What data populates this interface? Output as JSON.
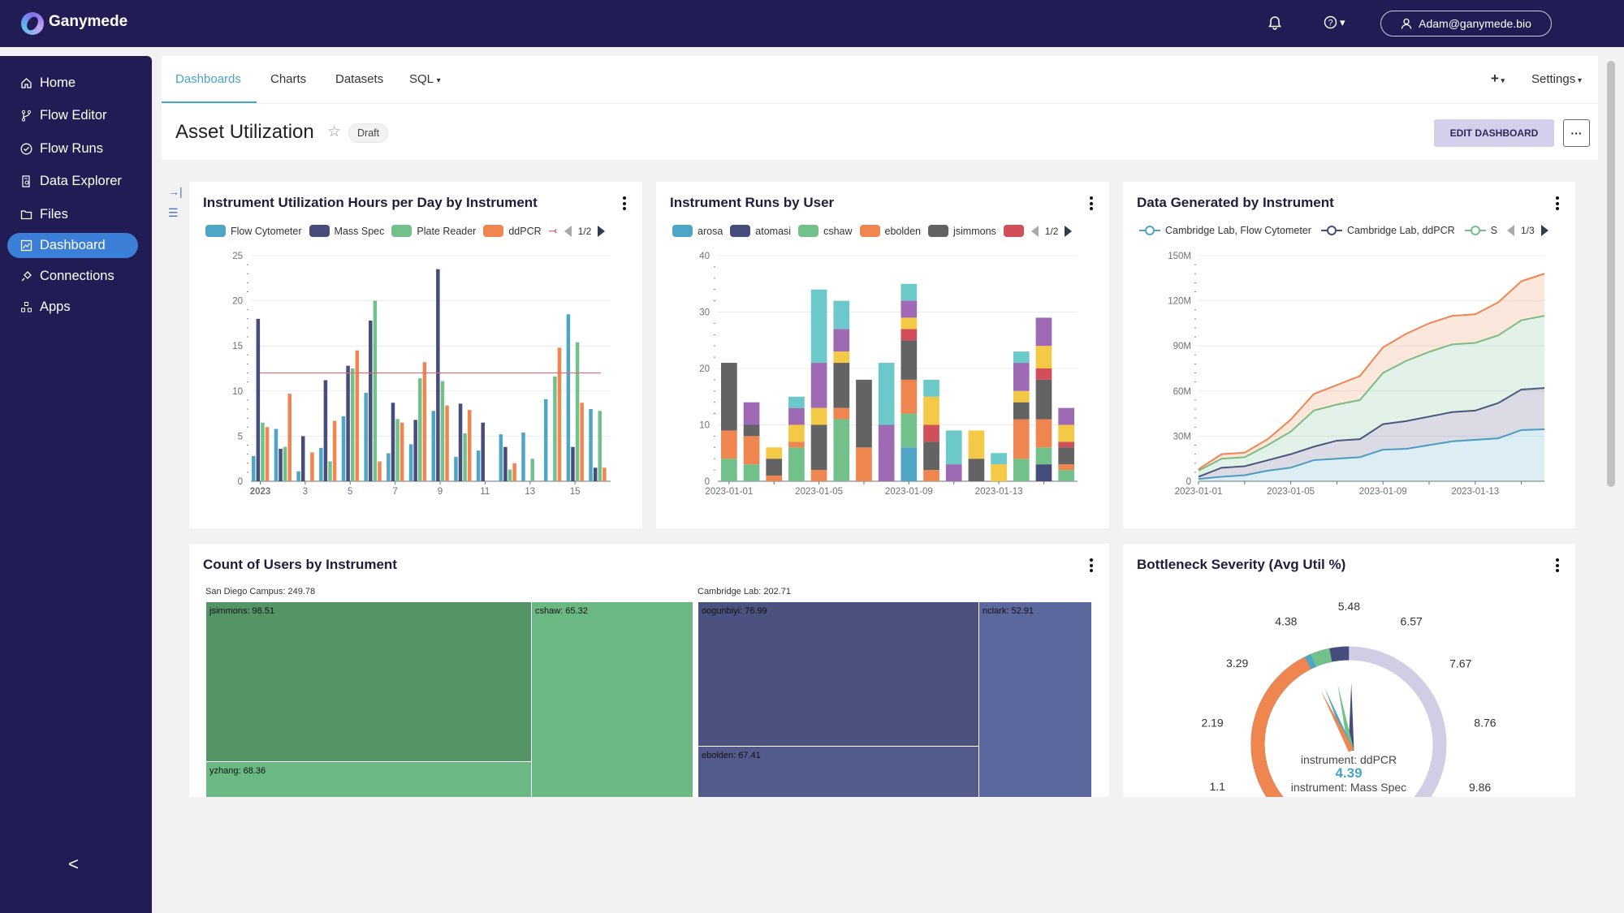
{
  "app": {
    "name": "Ganymede"
  },
  "header": {
    "user": "Adam@ganymede.bio",
    "bell_icon": "bell-icon",
    "help_icon": "help-icon"
  },
  "sidebar": {
    "items": [
      {
        "label": "Home",
        "icon": "home-icon"
      },
      {
        "label": "Flow Editor",
        "icon": "branch-icon"
      },
      {
        "label": "Flow Runs",
        "icon": "check-circle-icon"
      },
      {
        "label": "Data Explorer",
        "icon": "file-search-icon"
      },
      {
        "label": "Files",
        "icon": "folder-icon"
      },
      {
        "label": "Dashboard",
        "icon": "chart-icon"
      },
      {
        "label": "Connections",
        "icon": "plug-icon"
      },
      {
        "label": "Apps",
        "icon": "apps-icon"
      }
    ],
    "active": "Dashboard",
    "collapse": "<"
  },
  "tabs": [
    {
      "label": "Dashboards"
    },
    {
      "label": "Charts"
    },
    {
      "label": "Datasets"
    },
    {
      "label": "SQL"
    }
  ],
  "toolbar": {
    "plus": "+",
    "settings": "Settings"
  },
  "dashboard": {
    "title": "Asset Utilization",
    "status": "Draft",
    "edit_label": "EDIT DASHBOARD",
    "more_label": "···"
  },
  "colors": {
    "accent": "#4aa3c9",
    "nav_bg": "#211d54",
    "active_nav": "#3b7fd8"
  },
  "chart_data": [
    {
      "type": "bar",
      "title": "Instrument Utilization Hours per Day by Instrument",
      "legend_page": "1/2",
      "categories": [
        "2023-01-01",
        "2023-01-02",
        "2023-01-03",
        "2023-01-04",
        "2023-01-05",
        "2023-01-06",
        "2023-01-07",
        "2023-01-08",
        "2023-01-09",
        "2023-01-10",
        "2023-01-11",
        "2023-01-12",
        "2023-01-13",
        "2023-01-14",
        "2023-01-15",
        "2023-01-16"
      ],
      "tick_labels": [
        "2023",
        "3",
        "5",
        "7",
        "9",
        "11",
        "13",
        "15"
      ],
      "ylim": [
        0,
        25
      ],
      "yticks": [
        0,
        5,
        10,
        15,
        20,
        25
      ],
      "grid": true,
      "legend": "top",
      "mark_line": 12,
      "mark_line_color": "#e06b73",
      "series": [
        {
          "name": "Flow Cytometer",
          "color": "#4ea5c6",
          "values": [
            2.8,
            5.8,
            1.1,
            3.7,
            7.2,
            9.8,
            3.1,
            4.1,
            7.8,
            2.7,
            3.4,
            5.2,
            5.4,
            9.1,
            18.5,
            8
          ]
        },
        {
          "name": "Mass Spec",
          "color": "#464c7c",
          "values": [
            18,
            3.6,
            5,
            11.2,
            12.8,
            17.8,
            8.7,
            6.8,
            23.5,
            8.6,
            6.5,
            3.8,
            0,
            0,
            3.8,
            1.5
          ]
        },
        {
          "name": "Plate Reader",
          "color": "#72c08a",
          "values": [
            6.5,
            3.8,
            0,
            2.2,
            12.5,
            20,
            6.9,
            11.4,
            11.1,
            5.3,
            0,
            1.3,
            2.5,
            11.6,
            15.4,
            7.8
          ]
        },
        {
          "name": "ddPCR",
          "color": "#ef8650",
          "values": [
            6,
            9.7,
            3.2,
            6.7,
            14.5,
            2.2,
            6.5,
            13.2,
            8.4,
            7.9,
            0,
            2,
            0,
            14.8,
            8.7,
            1.5
          ]
        }
      ]
    },
    {
      "type": "bar",
      "stacked": true,
      "title": "Instrument Runs by User",
      "legend_page": "1/2",
      "categories": [
        "2023-01-01",
        "2023-01-02",
        "2023-01-03",
        "2023-01-04",
        "2023-01-05",
        "2023-01-06",
        "2023-01-07",
        "2023-01-08",
        "2023-01-09",
        "2023-01-10",
        "2023-01-11",
        "2023-01-12",
        "2023-01-13",
        "2023-01-14",
        "2023-01-15",
        "2023-01-16"
      ],
      "tick_labels": [
        "2023-01-01",
        "2023-01-05",
        "2023-01-09",
        "2023-01-13"
      ],
      "ylim": [
        0,
        40
      ],
      "yticks": [
        0,
        10,
        20,
        30,
        40
      ],
      "grid": true,
      "legend": "top",
      "series": [
        {
          "name": "arosa",
          "color": "#4ea5c6",
          "values": [
            0,
            0,
            0,
            0,
            0,
            0,
            0,
            0,
            6,
            0,
            0,
            0,
            0,
            0,
            0,
            0
          ]
        },
        {
          "name": "atomasi",
          "color": "#464c7c",
          "values": [
            0,
            0,
            0,
            0,
            0,
            0,
            0,
            0,
            0,
            0,
            0,
            0,
            0,
            0,
            3,
            0
          ]
        },
        {
          "name": "cshaw",
          "color": "#72c08a",
          "values": [
            4,
            3,
            0,
            6,
            0,
            11,
            0,
            0,
            6,
            0,
            0,
            0,
            0,
            4,
            3,
            2
          ]
        },
        {
          "name": "ebolden",
          "color": "#ef8650",
          "values": [
            5,
            5,
            1,
            1,
            2,
            2,
            6,
            0,
            6,
            2,
            0,
            0,
            0,
            7,
            5,
            1
          ]
        },
        {
          "name": "jsimmons",
          "color": "#636363",
          "values": [
            12,
            2,
            3,
            0,
            8,
            8,
            12,
            0,
            7,
            5,
            0,
            4,
            0,
            3,
            7,
            3
          ]
        },
        {
          "color": "#d04f58",
          "values": [
            0,
            0,
            0,
            0,
            0,
            0,
            0,
            0,
            2,
            3,
            0,
            0,
            0,
            0,
            2,
            1
          ]
        },
        {
          "color": "#f4c945",
          "values": [
            0,
            0,
            2,
            3,
            3,
            2,
            0,
            0,
            2,
            5,
            0,
            5,
            3,
            2,
            4,
            3
          ]
        },
        {
          "color": "#9e6ab4",
          "values": [
            0,
            4,
            0,
            3,
            8,
            4,
            0,
            10,
            3,
            0,
            3,
            0,
            0,
            5,
            5,
            3
          ]
        },
        {
          "color": "#6cc9c9",
          "values": [
            0,
            0,
            0,
            2,
            13,
            5,
            0,
            11,
            3,
            3,
            6,
            0,
            2,
            2,
            0,
            0
          ]
        }
      ]
    },
    {
      "type": "area",
      "stacked": true,
      "title": "Data Generated by Instrument",
      "legend_page": "1/3",
      "x": [
        "2023-01-01",
        "2023-01-02",
        "2023-01-03",
        "2023-01-04",
        "2023-01-05",
        "2023-01-06",
        "2023-01-07",
        "2023-01-08",
        "2023-01-09",
        "2023-01-10",
        "2023-01-11",
        "2023-01-12",
        "2023-01-13",
        "2023-01-14",
        "2023-01-15",
        "2023-01-16"
      ],
      "tick_labels": [
        "2023-01-01",
        "2023-01-05",
        "2023-01-09",
        "2023-01-13"
      ],
      "ylim": [
        0,
        150000000
      ],
      "ytick_labels": [
        "0",
        "30M",
        "60M",
        "90M",
        "120M",
        "150M"
      ],
      "grid": true,
      "legend": "top",
      "series": [
        {
          "name": "Cambridge Lab, Flow Cytometer",
          "color": "#4ea5c6",
          "values": [
            1.5,
            3,
            4,
            7,
            9,
            14,
            15,
            16,
            21,
            21.5,
            24,
            26.5,
            27.5,
            28.5,
            34,
            34.5
          ],
          "unit": "M"
        },
        {
          "name": "Cambridge Lab, ddPCR",
          "color": "#464c7c",
          "values": [
            1.5,
            6,
            6,
            7,
            9,
            9,
            12,
            12,
            17,
            18.5,
            19,
            19.5,
            19.5,
            23.5,
            27,
            27.5
          ],
          "unit": "M"
        },
        {
          "name": "S",
          "color": "#72c08a",
          "values": [
            4,
            6,
            6,
            10,
            15,
            24,
            24,
            26,
            34,
            40,
            43,
            45,
            45,
            45,
            46,
            48
          ],
          "unit": "M"
        },
        {
          "color": "#ef8650",
          "values": [
            1,
            3,
            3,
            4,
            8,
            11,
            13,
            16,
            17,
            18,
            19,
            19,
            19,
            22,
            26,
            28
          ],
          "unit": "M"
        }
      ]
    },
    {
      "type": "treemap",
      "title": "Count of Users by Instrument",
      "groups": [
        {
          "label": "San Diego Campus: 249.78",
          "children": [
            {
              "label": "jsimmons: 98.51",
              "color": "#559467"
            },
            {
              "label": "yzhang: 68.36",
              "color": "#6ab883"
            },
            {
              "label": "cshaw: 65.32",
              "color": "#6ab883"
            }
          ]
        },
        {
          "label": "Cambridge Lab: 202.71",
          "children": [
            {
              "label": "oogunbiyi: 76.99",
              "color": "#4b527f"
            },
            {
              "label": "ebolden: 67.41",
              "color": "#525b8c"
            },
            {
              "label": "nclark: 52.91",
              "color": "#5c679e"
            }
          ]
        }
      ]
    },
    {
      "type": "gauge",
      "title": "Bottleneck Severity (Avg Util %)",
      "min": 0,
      "max": 10.95,
      "axis_labels": [
        "1.1",
        "2.19",
        "3.29",
        "4.38",
        "5.48",
        "6.57",
        "7.67",
        "8.76",
        "9.86"
      ],
      "axis_values": [
        1.1,
        2.19,
        3.29,
        4.38,
        5.48,
        6.57,
        7.67,
        8.76,
        9.86
      ],
      "track_color": "#d1cde5",
      "series": [
        {
          "name": "instrument: Mass Spec",
          "color": "#464c7c",
          "value": 5.48
        },
        {
          "color": "#72c08a",
          "value": 5.01
        },
        {
          "color": "#4ea5c6",
          "value": 4.55
        },
        {
          "name": "instrument: ddPCR",
          "color": "#ef8650",
          "value": 4.39
        }
      ],
      "detail": {
        "label": "instrument: ddPCR",
        "value": "4.39",
        "label2": "instrument: Mass Spec"
      }
    }
  ]
}
